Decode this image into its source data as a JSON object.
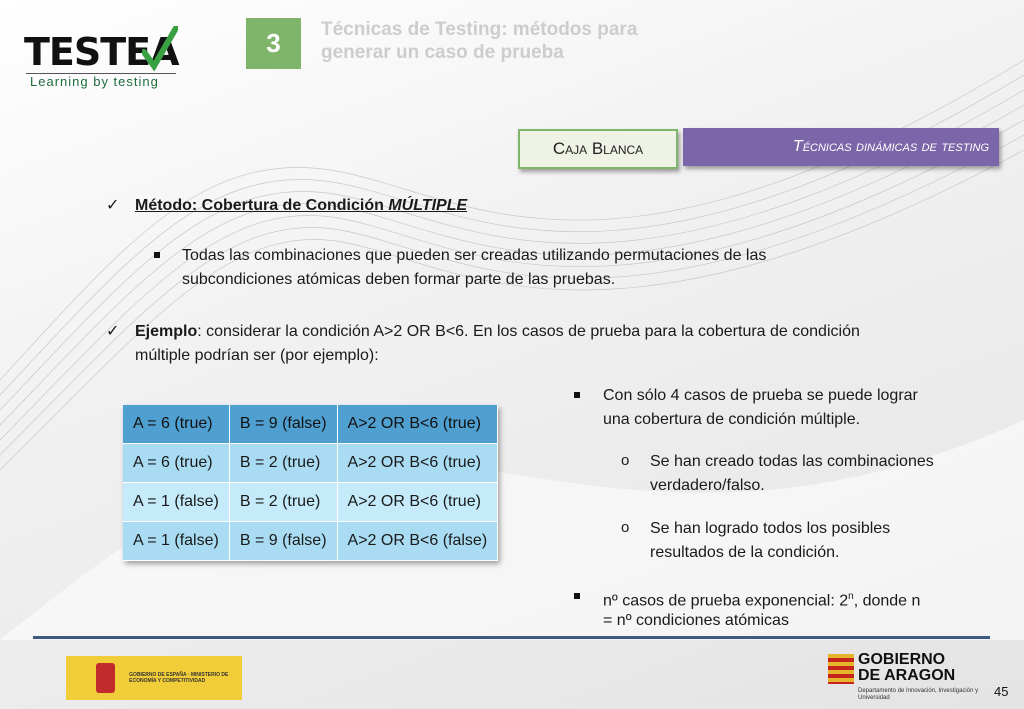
{
  "header": {
    "logo_text": "TESTEA",
    "logo_sub": "Learning by testing",
    "section_number": "3",
    "title_line1": "Técnicas de Testing: métodos para",
    "title_line2": "generar un caso de prueba"
  },
  "tags": {
    "caja": "Caja Blanca",
    "tecnicas": "Técnicas dinámicas de testing"
  },
  "content": {
    "metodo_label": "Método: Cobertura de Condición ",
    "metodo_emph": "MÚLTIPLE",
    "sub1_line1": "Todas las combinaciones que pueden ser creadas utilizando permutaciones de las",
    "sub1_line2": "subcondiciones atómicas deben formar parte de las pruebas.",
    "ejemplo_label": "Ejemplo",
    "ejemplo_line1": ": considerar la condición A>2 OR B<6. En los casos de prueba para la cobertura de condición",
    "ejemplo_line2": "múltiple podrían ser (por ejemplo):",
    "right_b1_line1": "Con sólo 4 casos de prueba se puede lograr",
    "right_b1_line2": "una cobertura de condición múltiple.",
    "right_o1_line1": "Se han creado todas las combinaciones",
    "right_o1_line2": "verdadero/falso.",
    "right_o2_line1": "Se han logrado todos los posibles",
    "right_o2_line2": "resultados de la condición.",
    "right_b2_line1a": "nº casos de prueba exponencial: 2",
    "right_b2_sup": "n",
    "right_b2_line1b": ", donde n",
    "right_b2_line2": "= nº condiciones atómicas"
  },
  "table": {
    "rows": [
      [
        "A = 6 (true)",
        "B = 9 (false)",
        "A>2 OR B<6 (true)"
      ],
      [
        "A = 6 (true)",
        "B = 2 (true)",
        "A>2 OR B<6 (true)"
      ],
      [
        "A = 1 (false)",
        "B = 2 (true)",
        "A>2 OR B<6 (true)"
      ],
      [
        "A = 1 (false)",
        "B = 9 (false)",
        "A>2 OR B<6 (false)"
      ]
    ]
  },
  "footer": {
    "gov_es_text": "GOBIERNO DE ESPAÑA · MINISTERIO DE ECONOMÍA Y COMPETITIVIDAD",
    "aragon_line1": "GOBIERNO",
    "aragon_line2": "DE ARAGON",
    "aragon_dept": "Departamento de Innovación, Investigación y Universidad",
    "page_number": "45"
  },
  "colors": {
    "green": "#7fb56a",
    "purple": "#7a66a8",
    "table_header": "#4f9fd0",
    "table_row": "#a9dcf3",
    "footer_rule": "#3f5a80"
  }
}
